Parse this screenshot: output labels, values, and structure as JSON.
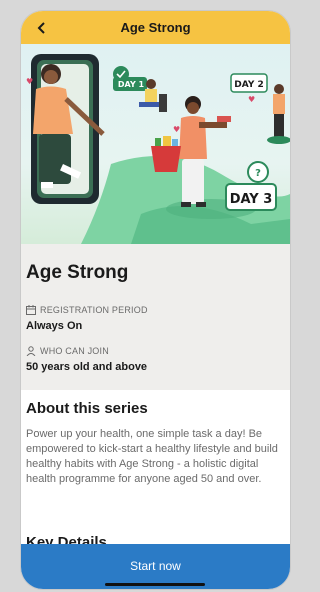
{
  "header": {
    "title": "Age Strong",
    "back_icon": "chevron-left-icon"
  },
  "hero": {
    "day_badges": [
      "DAY 1",
      "DAY 2",
      "DAY 3"
    ]
  },
  "series": {
    "name": "Age Strong",
    "registration_label": "REGISTRATION PERIOD",
    "registration_value": "Always On",
    "who_label": "WHO CAN JOIN",
    "who_value": "50 years old and above"
  },
  "about": {
    "heading": "About this series",
    "body": "Power up your health, one simple task a day! Be empowered to kick-start a healthy lifestyle and build healthy habits with Age Strong - a holistic digital health programme for anyone aged 50 and over.",
    "key_details": "Key Details"
  },
  "footer": {
    "start_label": "Start now"
  },
  "colors": {
    "header": "#f6c342",
    "button": "#2b7bc6",
    "accent_green": "#2c8a5b"
  }
}
